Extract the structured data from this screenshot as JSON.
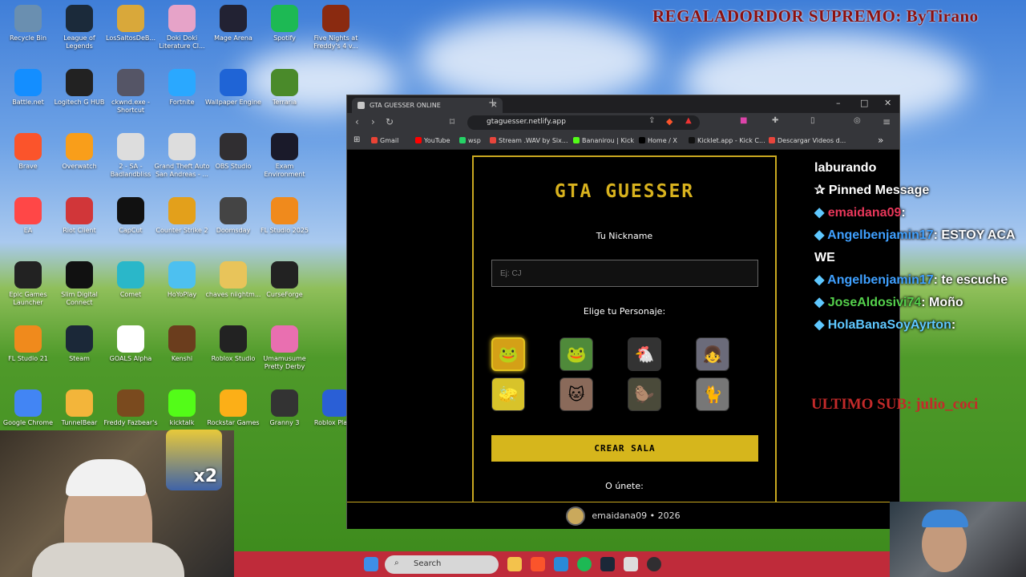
{
  "stream_overlay": {
    "title": "REGALADORDOR SUPREMO: ByTirano",
    "ultimo_sub": "ULTIMO SUB: julio_coci",
    "webcam_badge": "x2"
  },
  "desktop_icons": [
    {
      "label": "Recycle Bin",
      "icon": "recycle-bin-icon",
      "color": "#6a8fb0"
    },
    {
      "label": "League of Legends",
      "icon": "league-icon",
      "color": "#1b2a3a"
    },
    {
      "label": "LosSaltosDeB...",
      "icon": "folder-icon",
      "color": "#d9a83a"
    },
    {
      "label": "Doki Doki Literature Cl...",
      "icon": "doki-icon",
      "color": "#e6a3c8"
    },
    {
      "label": "Mage Arena",
      "icon": "mage-icon",
      "color": "#223"
    },
    {
      "label": "Spotify",
      "icon": "spotify-icon",
      "color": "#1db954"
    },
    {
      "label": "Five Nights at Freddy's 4 v...",
      "icon": "fnaf-icon",
      "color": "#8a2a10"
    },
    {
      "label": "Battle.net",
      "icon": "battlenet-icon",
      "color": "#148eff"
    },
    {
      "label": "Logitech G HUB",
      "icon": "logitech-icon",
      "color": "#222"
    },
    {
      "label": "ckwnd.exe - Shortcut",
      "icon": "shortcut-icon",
      "color": "#556"
    },
    {
      "label": "Fortnite",
      "icon": "fortnite-icon",
      "color": "#2aa8ff"
    },
    {
      "label": "Wallpaper Engine",
      "icon": "wallpaper-icon",
      "color": "#1f64d6"
    },
    {
      "label": "Terraria",
      "icon": "terraria-icon",
      "color": "#4a8a2a"
    },
    {
      "label": "Brave",
      "icon": "brave-icon",
      "color": "#fb542b"
    },
    {
      "label": "Overwatch",
      "icon": "overwatch-icon",
      "color": "#f99e1a"
    },
    {
      "label": "2 - SA - Badlandbliss",
      "icon": "sa-icon",
      "color": "#ddd"
    },
    {
      "label": "Grand Theft Auto San Andreas - ...",
      "icon": "gta-icon",
      "color": "#ddd"
    },
    {
      "label": "OBS Studio",
      "icon": "obs-icon",
      "color": "#302e31"
    },
    {
      "label": "Exam Environment",
      "icon": "exam-icon",
      "color": "#1a1a2a"
    },
    {
      "label": "EA",
      "icon": "ea-icon",
      "color": "#ff4747"
    },
    {
      "label": "Riot Client",
      "icon": "riot-icon",
      "color": "#d13639"
    },
    {
      "label": "CapCut",
      "icon": "capcut-icon",
      "color": "#111"
    },
    {
      "label": "Counter Strike 2",
      "icon": "cs2-icon",
      "color": "#e3a01b"
    },
    {
      "label": "Doomsday",
      "icon": "doomsday-icon",
      "color": "#444"
    },
    {
      "label": "FL Studio 2025",
      "icon": "flstudio-icon",
      "color": "#f08a1c"
    },
    {
      "label": "Epic Games Launcher",
      "icon": "epic-icon",
      "color": "#222"
    },
    {
      "label": "Slim Digital Connect",
      "icon": "slim-icon",
      "color": "#111"
    },
    {
      "label": "Comet",
      "icon": "comet-icon",
      "color": "#2ab7c9"
    },
    {
      "label": "HoYoPlay",
      "icon": "hoyoplay-icon",
      "color": "#4dc0f0"
    },
    {
      "label": "chaves niightm...",
      "icon": "folder-icon",
      "color": "#e8c45a"
    },
    {
      "label": "CurseForge",
      "icon": "curseforge-icon",
      "color": "#222"
    },
    {
      "label": "FL Studio 21",
      "icon": "flstudio21-icon",
      "color": "#f08a1c"
    },
    {
      "label": "Steam",
      "icon": "steam-icon",
      "color": "#1b2838"
    },
    {
      "label": "GOALS Alpha",
      "icon": "goals-icon",
      "color": "#fff"
    },
    {
      "label": "Kenshi",
      "icon": "kenshi-icon",
      "color": "#6b3d1d"
    },
    {
      "label": "Roblox Studio",
      "icon": "robloxstudio-icon",
      "color": "#222"
    },
    {
      "label": "Umamusume Pretty Derby",
      "icon": "umamusume-icon",
      "color": "#e96fb0"
    },
    {
      "label": "Google Chrome",
      "icon": "chrome-icon",
      "color": "#4285f4"
    },
    {
      "label": "TunnelBear",
      "icon": "tunnelbear-icon",
      "color": "#f3b53a"
    },
    {
      "label": "Freddy Fazbear's",
      "icon": "freddy-icon",
      "color": "#7a4a1e"
    },
    {
      "label": "kicktalk",
      "icon": "kick-icon",
      "color": "#53fc18"
    },
    {
      "label": "Rockstar Games",
      "icon": "rockstar-icon",
      "color": "#fcaf17"
    },
    {
      "label": "Granny 3",
      "icon": "granny-icon",
      "color": "#333"
    },
    {
      "label": "Roblox Player",
      "icon": "roblox-icon",
      "color": "#2a5fd6"
    }
  ],
  "browser": {
    "tab_title": "GTA GUESSER ONLINE",
    "url": "gtaguesser.netlify.app",
    "bookmarks": [
      "Gmail",
      "YouTube",
      "wsp",
      "Stream .WAV by Six...",
      "Bananirou | Kick",
      "Home / X",
      "Kicklet.app - Kick C...",
      "Descargar Videos d..."
    ],
    "bookmark_colors": [
      "#ea4335",
      "#ff0000",
      "#25d366",
      "#e8453c",
      "#53fc18",
      "#000000",
      "#111111",
      "#e8453c"
    ]
  },
  "page": {
    "title": "GTA GUESSER",
    "nickname_label": "Tu Nickname",
    "nickname_placeholder": "Ej: CJ",
    "character_label": "Elige tu Personaje:",
    "characters": [
      {
        "icon": "golden-frog-icon",
        "selected": true,
        "color": "#d4a017"
      },
      {
        "icon": "pepe-icon",
        "selected": false,
        "color": "#4f8a3a"
      },
      {
        "icon": "chicken-icon",
        "selected": false,
        "color": "#333"
      },
      {
        "icon": "anime-girl-icon",
        "selected": false,
        "color": "#6b6b7a"
      },
      {
        "icon": "spongebob-icon",
        "selected": false,
        "color": "#d8c32a"
      },
      {
        "icon": "cat-icon",
        "selected": false,
        "color": "#8a6a5a"
      },
      {
        "icon": "capybara-icon",
        "selected": false,
        "color": "#4a4a3a"
      },
      {
        "icon": "cat-fan-icon",
        "selected": false,
        "color": "#777"
      }
    ],
    "create_button": "CREAR SALA",
    "join_label": "O únete:",
    "footer": "emaidana09 • 2026"
  },
  "chat": {
    "top_partial": "laburando",
    "pinned": "Pinned Message",
    "messages": [
      {
        "user": "emaidana09",
        "text": ":",
        "style": "u1"
      },
      {
        "user": "Angelbenjamin17",
        "text": ": ESTOY ACA WE",
        "style": "u2"
      },
      {
        "user": "Angelbenjamin17",
        "text": ": te escuche",
        "style": "u2"
      },
      {
        "user": "JoseAldosivi74",
        "text": ": Moño",
        "style": "u3"
      },
      {
        "user": "HolaBanaSoyAyrton",
        "text": ":",
        "style": "u4"
      }
    ]
  },
  "taskbar": {
    "search_label": "Search"
  }
}
